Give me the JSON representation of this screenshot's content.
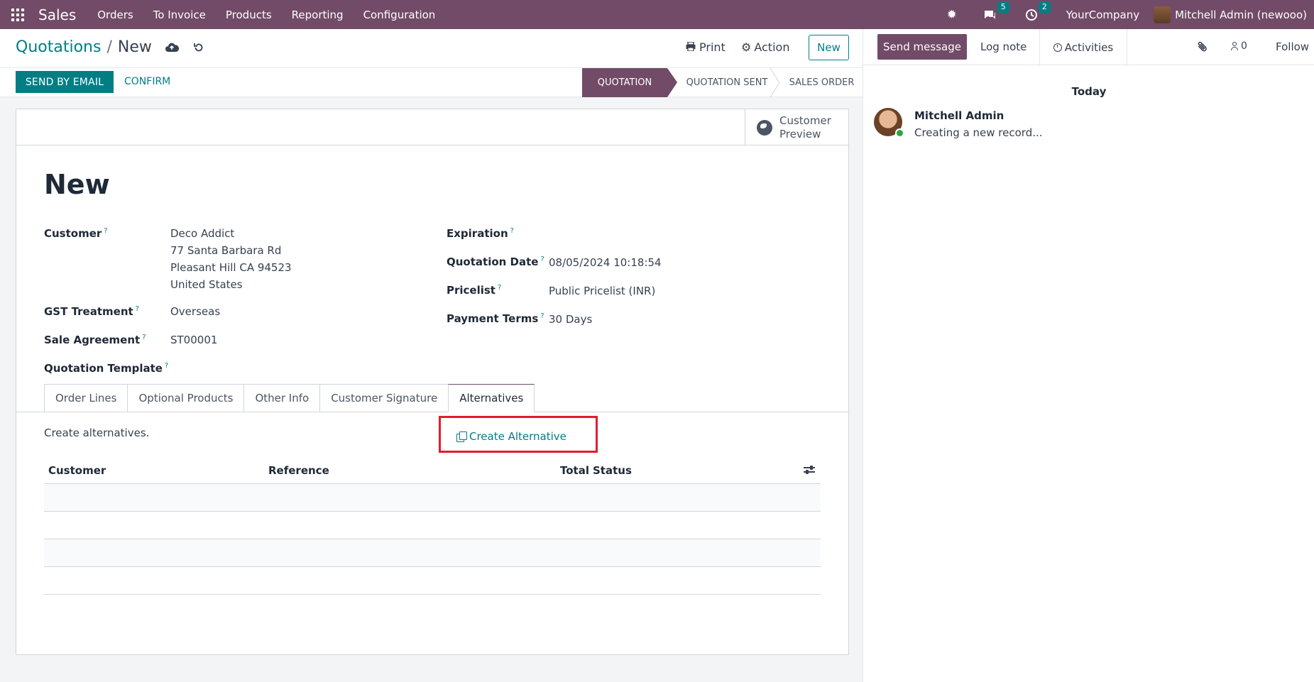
{
  "navbar": {
    "app_name": "Sales",
    "menu": [
      "Orders",
      "To Invoice",
      "Products",
      "Reporting",
      "Configuration"
    ],
    "messages_badge": "5",
    "activities_badge": "2",
    "company": "YourCompany",
    "user": "Mitchell Admin (newooo)",
    "accent_color": "#714b67"
  },
  "control_panel": {
    "breadcrumb_parent": "Quotations",
    "breadcrumb_separator": "/",
    "breadcrumb_current": "New",
    "print_label": "Print",
    "action_label": "Action",
    "new_label": "New"
  },
  "statusbar": {
    "send_email_label": "SEND BY EMAIL",
    "confirm_label": "CONFIRM",
    "stages": [
      "QUOTATION",
      "QUOTATION SENT",
      "SALES ORDER"
    ],
    "active_stage": "QUOTATION"
  },
  "sheet": {
    "customer_preview_line1": "Customer",
    "customer_preview_line2": "Preview",
    "title": "New",
    "help_mark": "?",
    "fields": {
      "customer_label": "Customer",
      "customer_lines": [
        "Deco Addict",
        "77 Santa Barbara Rd",
        "Pleasant Hill CA 94523",
        "United States"
      ],
      "gst_label": "GST Treatment",
      "gst_value": "Overseas",
      "agreement_label": "Sale Agreement",
      "agreement_value": "ST00001",
      "template_label": "Quotation Template",
      "expiration_label": "Expiration",
      "quotation_date_label": "Quotation Date",
      "quotation_date_value": "08/05/2024 10:18:54",
      "pricelist_label": "Pricelist",
      "pricelist_value": "Public Pricelist (INR)",
      "payment_terms_label": "Payment Terms",
      "payment_terms_value": "30 Days"
    },
    "tabs": [
      "Order Lines",
      "Optional Products",
      "Other Info",
      "Customer Signature",
      "Alternatives"
    ],
    "active_tab": "Alternatives",
    "alternatives": {
      "description": "Create alternatives.",
      "create_button": "Create Alternative",
      "columns": [
        "Customer",
        "Reference",
        "Total",
        "Status"
      ]
    }
  },
  "chatter": {
    "send_message_label": "Send message",
    "log_note_label": "Log note",
    "activities_label": "Activities",
    "followers_count": "0",
    "follow_label": "Follow",
    "date_separator": "Today",
    "message_author": "Mitchell Admin",
    "message_body": "Creating a new record..."
  }
}
